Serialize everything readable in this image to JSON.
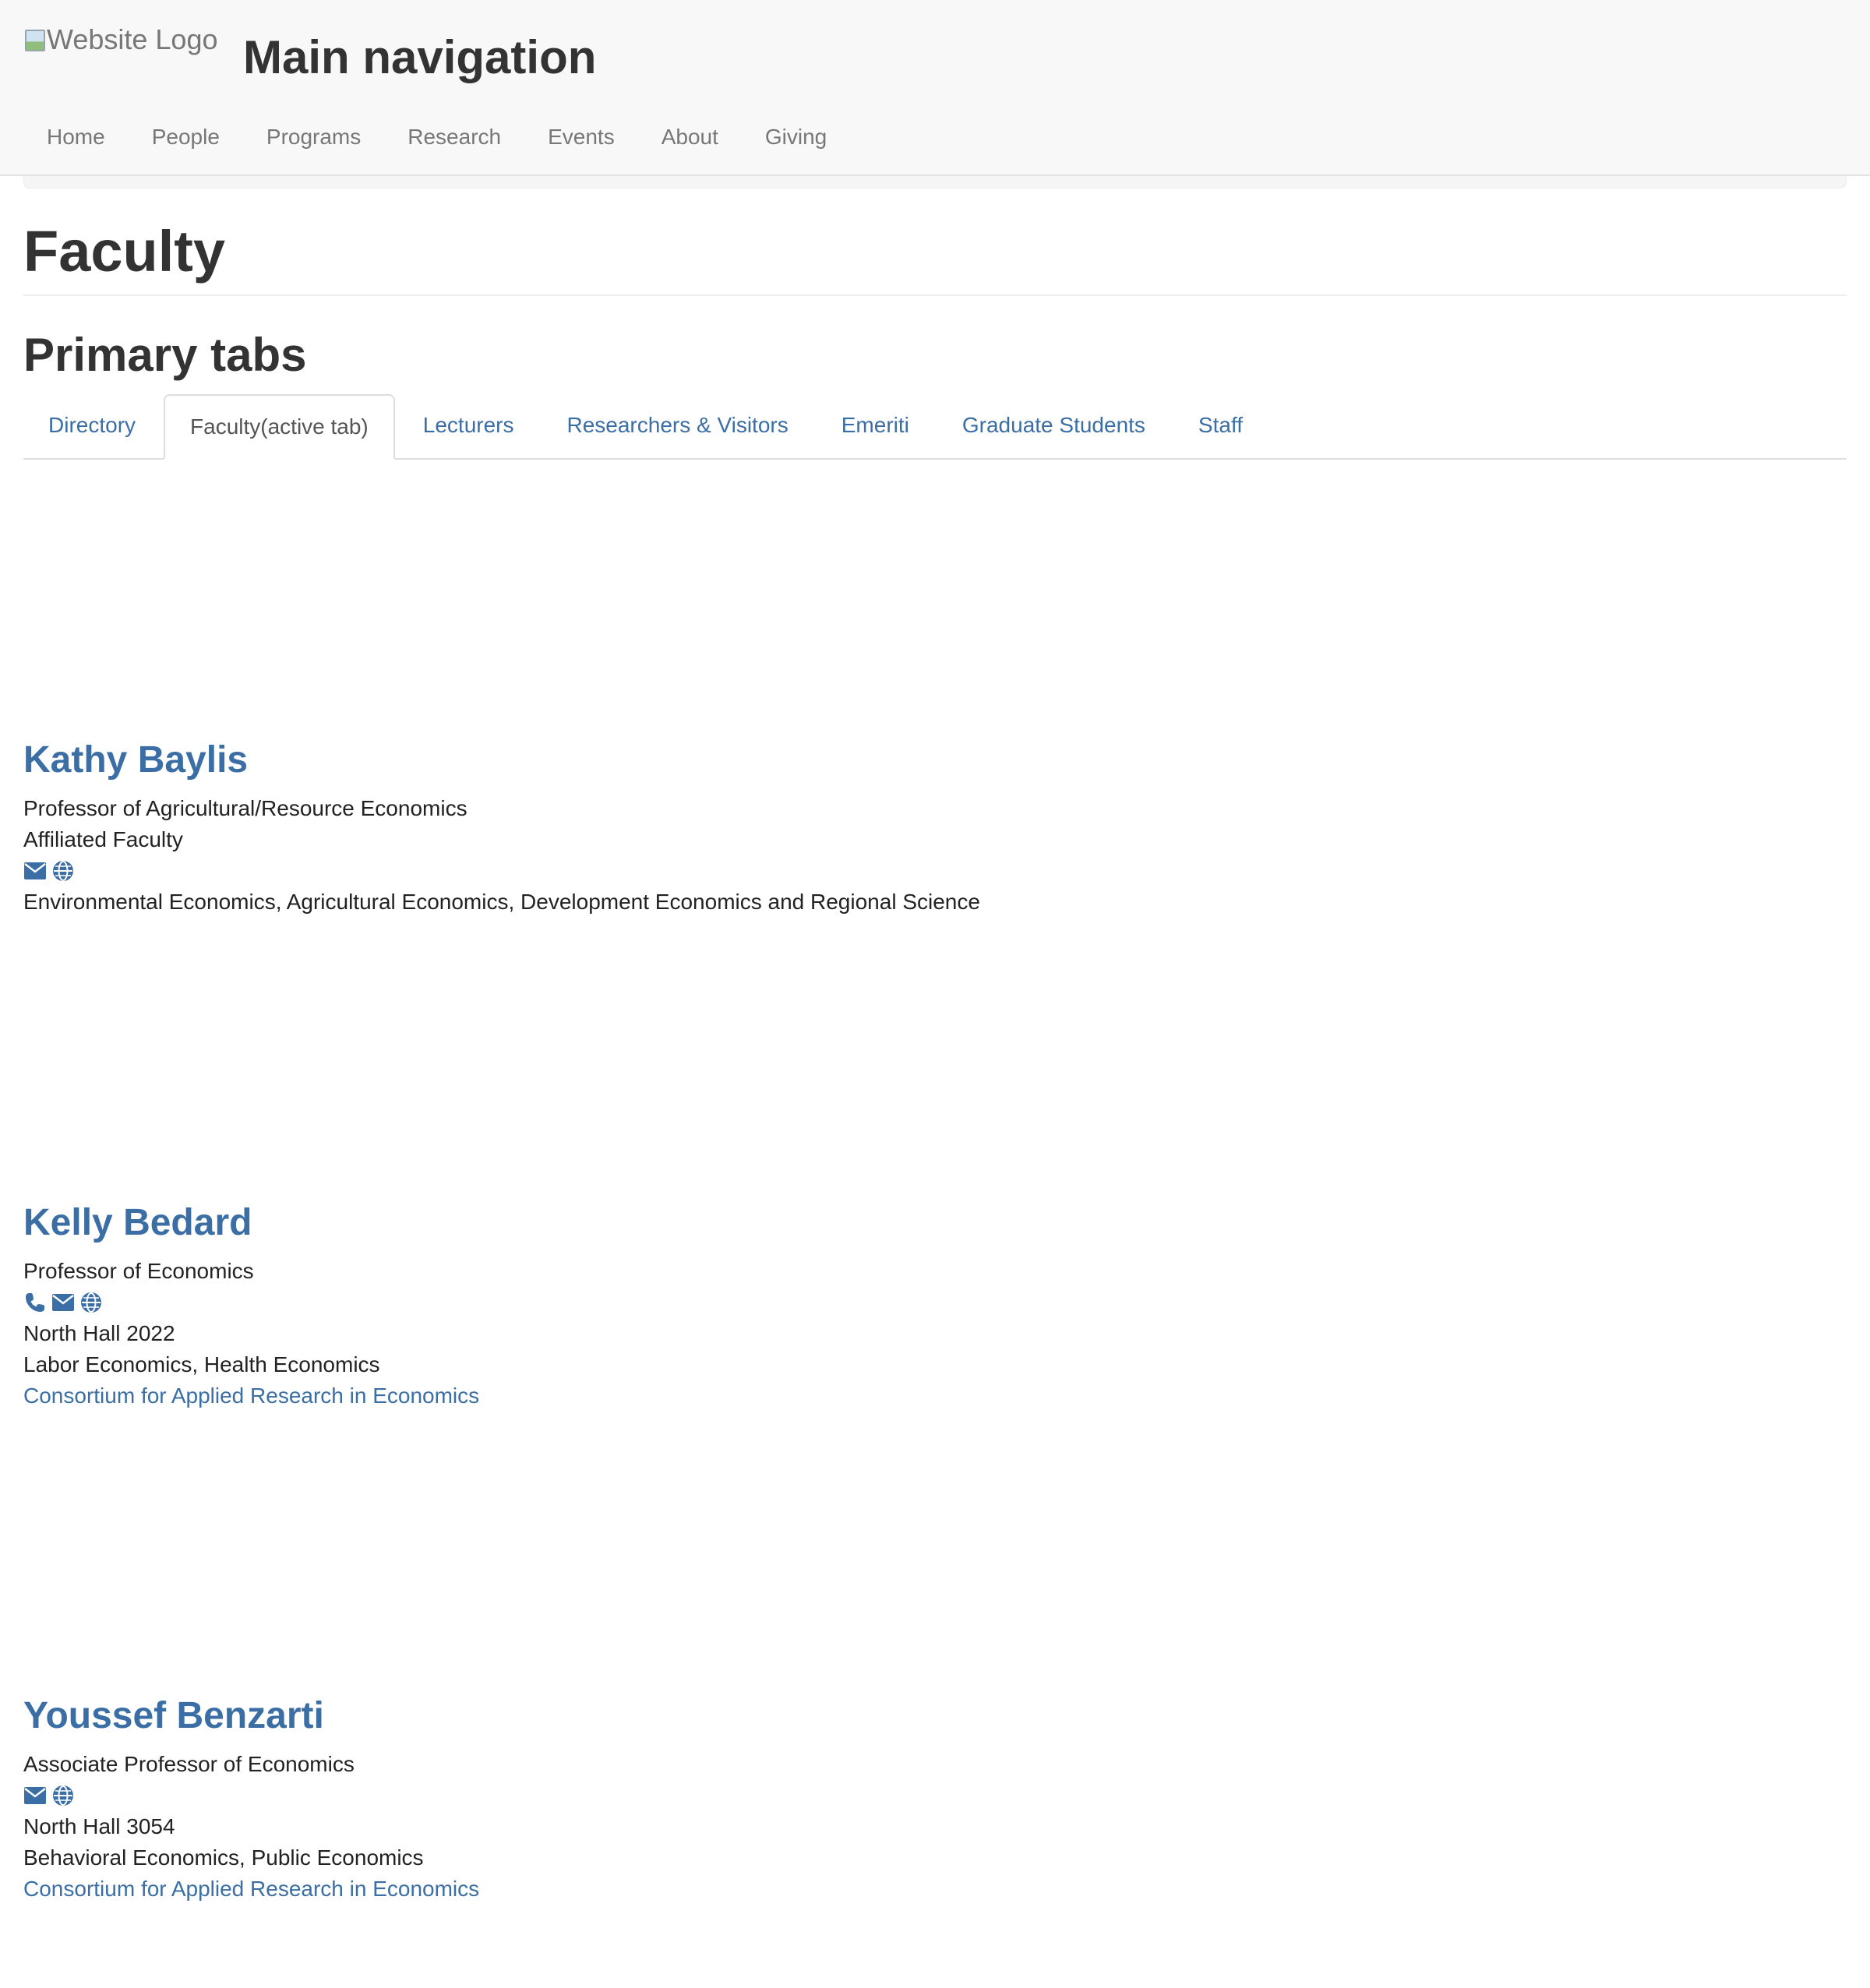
{
  "header": {
    "logo_alt": "Website Logo",
    "title": "Main navigation",
    "nav": [
      "Home",
      "People",
      "Programs",
      "Research",
      "Events",
      "About",
      "Giving"
    ]
  },
  "page": {
    "title": "Faculty",
    "tabs_heading": "Primary tabs"
  },
  "tabs": [
    {
      "label": "Directory",
      "active": false
    },
    {
      "label": "Faculty(active tab)",
      "active": true
    },
    {
      "label": "Lecturers",
      "active": false
    },
    {
      "label": "Researchers & Visitors",
      "active": false
    },
    {
      "label": "Emeriti",
      "active": false
    },
    {
      "label": "Graduate Students",
      "active": false
    },
    {
      "label": "Staff",
      "active": false
    }
  ],
  "people": [
    {
      "name": "Kathy Baylis",
      "titles": [
        "Professor of Agricultural/Resource Economics",
        "Affiliated Faculty"
      ],
      "icons": [
        "envelope-icon",
        "globe-icon"
      ],
      "office": "",
      "fields": "Environmental Economics, Agricultural Economics, Development Economics and Regional Science",
      "affiliation": ""
    },
    {
      "name": "Kelly Bedard",
      "titles": [
        "Professor of Economics"
      ],
      "icons": [
        "phone-icon",
        "envelope-icon",
        "globe-icon"
      ],
      "office": "North Hall 2022",
      "fields": "Labor Economics, Health Economics",
      "affiliation": "Consortium for Applied Research in Economics"
    },
    {
      "name": "Youssef Benzarti",
      "titles": [
        "Associate Professor of Economics"
      ],
      "icons": [
        "envelope-icon",
        "globe-icon"
      ],
      "office": "North Hall 3054",
      "fields": "Behavioral Economics, Public Economics",
      "affiliation": "Consortium for Applied Research in Economics"
    }
  ],
  "colors": {
    "link": "#3a6ea5",
    "header_bg": "#f8f8f8",
    "text": "#333333"
  }
}
